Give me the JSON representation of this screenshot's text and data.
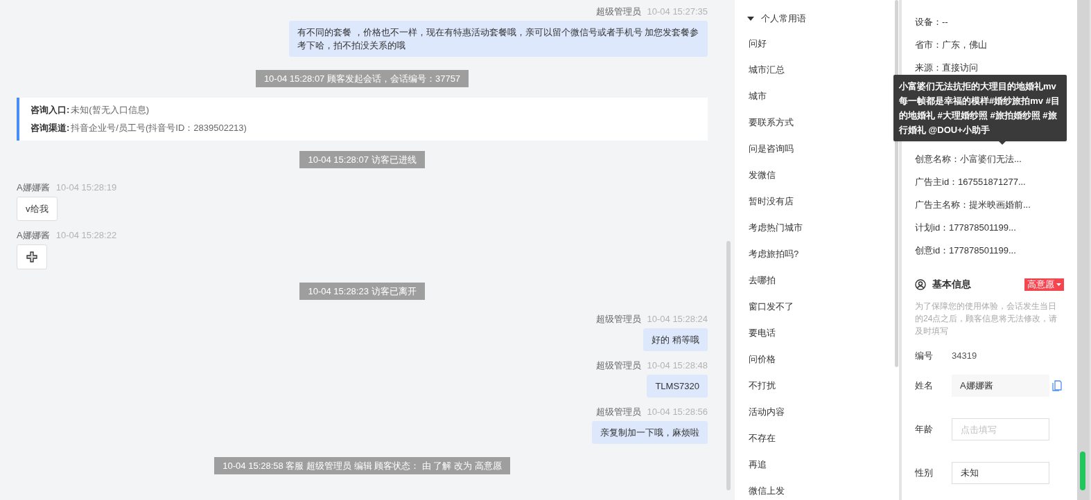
{
  "chat": {
    "messages": [
      {
        "kind": "agent",
        "sender": "超级管理员",
        "time": "10-04 15:27:35",
        "text": "有不同的套餐 ，价格也不一样，现在有特惠活动套餐哦，亲可以留个微信号或者手机号 加您发套餐参考下哈，拍不拍没关系的哦"
      },
      {
        "kind": "system",
        "text": "10-04 15:28:07 顾客发起会话，会话编号：37757"
      },
      {
        "kind": "card",
        "fields": [
          {
            "label": "咨询入口:",
            "value": "未知(暂无入口信息)"
          },
          {
            "label": "咨询渠道:",
            "value": "抖音企业号/员工号(抖音号ID：2839502213)"
          }
        ]
      },
      {
        "kind": "system",
        "text": "10-04 15:28:07 访客已进线"
      },
      {
        "kind": "visitor",
        "sender": "A娜娜酱",
        "time": "10-04 15:28:19",
        "text": "v给我"
      },
      {
        "kind": "image",
        "sender": "A娜娜酱",
        "time": "10-04 15:28:22"
      },
      {
        "kind": "system",
        "text": "10-04 15:28:23 访客已离开"
      },
      {
        "kind": "agent",
        "sender": "超级管理员",
        "time": "10-04 15:28:24",
        "text": "好的 稍等哦"
      },
      {
        "kind": "agent",
        "sender": "超级管理员",
        "time": "10-04 15:28:48",
        "text": "TLMS7320"
      },
      {
        "kind": "agent",
        "sender": "超级管理员",
        "time": "10-04 15:28:56",
        "text": "亲复制加一下哦，麻烦啦"
      },
      {
        "kind": "system",
        "text": "10-04 15:28:58 客服 超级管理员 编辑 顾客状态： 由 了解 改为 高意愿"
      }
    ]
  },
  "phrases": {
    "group": "个人常用语",
    "expanded": true,
    "items": [
      "问好",
      "城市汇总",
      "城市",
      "要联系方式",
      "问是咨询吗",
      "发微信",
      "暂时没有店",
      "考虑热门城市",
      "考虑旅拍吗?",
      "去哪拍",
      "窗口发不了",
      "要电话",
      "问价格",
      "不打扰",
      "活动内容",
      "不存在",
      "再追",
      "微信上发"
    ]
  },
  "customer": {
    "info": [
      {
        "kind": "text",
        "text": "设备：--"
      },
      {
        "kind": "text",
        "text": "省市：广东，佛山"
      },
      {
        "kind": "text",
        "text": "来源：直接访问"
      },
      {
        "kind": "hidden"
      },
      {
        "kind": "hidden"
      },
      {
        "kind": "hidden"
      },
      {
        "kind": "text",
        "text": "创意名称：小富婆们无法..."
      },
      {
        "kind": "text",
        "text": "广告主id：167551871277..."
      },
      {
        "kind": "text",
        "text": "广告主名称：提米映画婚前..."
      },
      {
        "kind": "text",
        "text": "计划id：177878501199..."
      },
      {
        "kind": "text",
        "text": "创意id：177878501199..."
      }
    ],
    "tooltip": "小富婆们无法抗拒的大理目的地婚礼mv 每一帧都是幸福的模样#婚纱旅拍mv #目的地婚礼 #大理婚纱照 #旅拍婚纱照 #旅行婚礼 @DOU+小助手",
    "basic": {
      "title": "基本信息",
      "tag": "高意愿",
      "notice": "为了保障您的使用体验，会话发生当日的24点之后，顾客信息将无法修改，请及时填写",
      "fields": [
        {
          "kind": "static",
          "label": "编号",
          "value": "34319"
        },
        {
          "kind": "readonly",
          "label": "姓名",
          "value": "A娜娜酱"
        },
        {
          "kind": "input",
          "label": "年龄",
          "placeholder": "点击填写"
        },
        {
          "kind": "input",
          "label": "性别",
          "value": "未知"
        }
      ]
    }
  }
}
